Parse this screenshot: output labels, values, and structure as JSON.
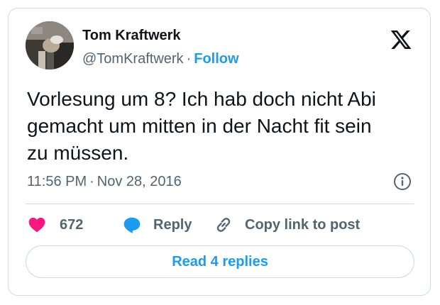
{
  "author": {
    "display_name": "Tom Kraftwerk",
    "handle": "@TomKraftwerk",
    "separator": "·",
    "follow_label": "Follow"
  },
  "tweet": {
    "text": "Vorlesung um 8? Ich hab doch nicht Abi\ngemacht um mitten in der Nacht fit sein\nzu müssen.",
    "time": "11:56 PM",
    "separator": "·",
    "date": "Nov 28, 2016"
  },
  "actions": {
    "like_count": "672",
    "reply_label": "Reply",
    "copy_link_label": "Copy link to post"
  },
  "read_replies_label": "Read 4 replies",
  "icons": {
    "brand": "x-logo-icon",
    "info": "info-icon",
    "like": "heart-icon",
    "reply": "speech-bubble-icon",
    "copy_link": "link-icon"
  },
  "colors": {
    "accent": "#1d9bf0",
    "like": "#f91880",
    "muted_text": "#536471",
    "border": "#cfd9de"
  }
}
